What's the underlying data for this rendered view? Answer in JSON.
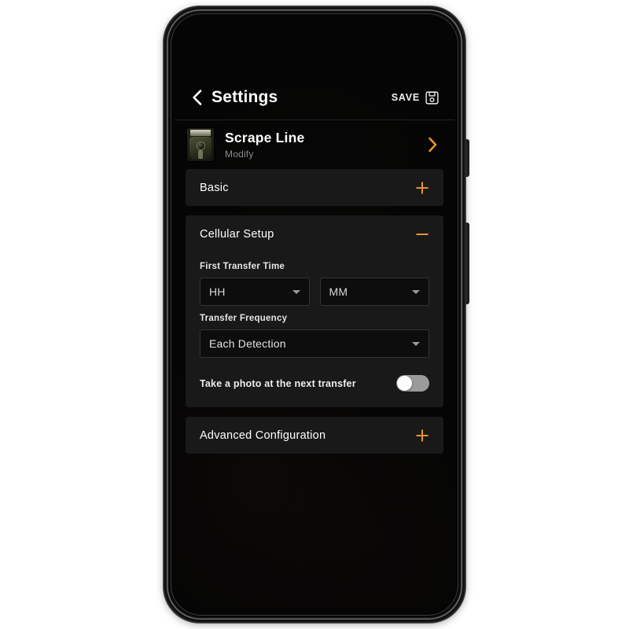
{
  "theme": {
    "accent": "#E8932A",
    "screen_background": "#050505",
    "section_background": "#191919",
    "text_primary": "#FFFFFF",
    "text_secondary": "#8A8A8A"
  },
  "appbar": {
    "back_icon": "chevron-left-icon",
    "title": "Settings",
    "save_label": "SAVE",
    "save_icon": "floppy-disk-save-icon"
  },
  "device": {
    "thumbnail_icon": "trail-camera-thumbnail",
    "name": "Scrape Line",
    "subtitle": "Modify",
    "chevron_icon": "chevron-right-icon"
  },
  "sections": [
    {
      "title": "Basic",
      "state": "collapsed",
      "toggle_icon": "plus-icon"
    },
    {
      "title": "Cellular Setup",
      "state": "expanded",
      "toggle_icon": "minus-icon",
      "fields": {
        "first_transfer_time": {
          "label": "First Transfer Time",
          "hour": {
            "value": "HH",
            "caret_icon": "caret-down-icon"
          },
          "minute": {
            "value": "MM",
            "caret_icon": "caret-down-icon"
          }
        },
        "transfer_frequency": {
          "label": "Transfer Frequency",
          "value": "Each Detection",
          "caret_icon": "caret-down-icon"
        },
        "photo_at_next_transfer": {
          "label": "Take a photo at the next transfer",
          "state": "off"
        }
      }
    },
    {
      "title": "Advanced Configuration",
      "state": "collapsed",
      "toggle_icon": "plus-icon"
    }
  ]
}
